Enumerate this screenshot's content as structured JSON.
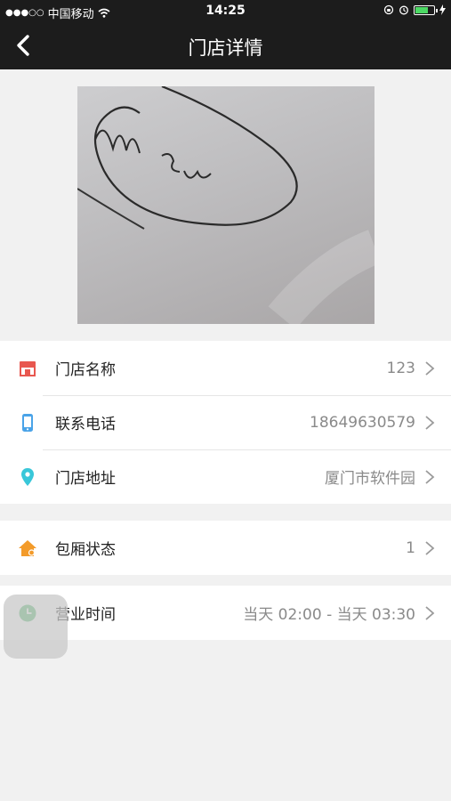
{
  "status_bar": {
    "signal": "●●●○○",
    "carrier": "中国移动",
    "time": "14:25"
  },
  "nav": {
    "title": "门店详情",
    "back_icon": "chevron-left-icon"
  },
  "store_photo": {
    "description_icon": "store-photo"
  },
  "rows_group1": [
    {
      "label": "门店名称",
      "value": "123",
      "icon": "store-icon",
      "color": "#e8574f"
    },
    {
      "label": "联系电话",
      "value": "18649630579",
      "icon": "phone-icon",
      "color": "#4aa3e8"
    },
    {
      "label": "门店地址",
      "value": "厦门市软件园",
      "icon": "location-pin-icon",
      "color": "#39c7d9"
    }
  ],
  "rows_group2": [
    {
      "label": "包厢状态",
      "value": "1",
      "icon": "room-status-icon",
      "color": "#f39b2a"
    }
  ],
  "rows_group3": [
    {
      "label": "营业时间",
      "value": "当天 02:00 - 当天 03:30",
      "icon": "clock-icon",
      "color": "#4bb96a"
    }
  ]
}
